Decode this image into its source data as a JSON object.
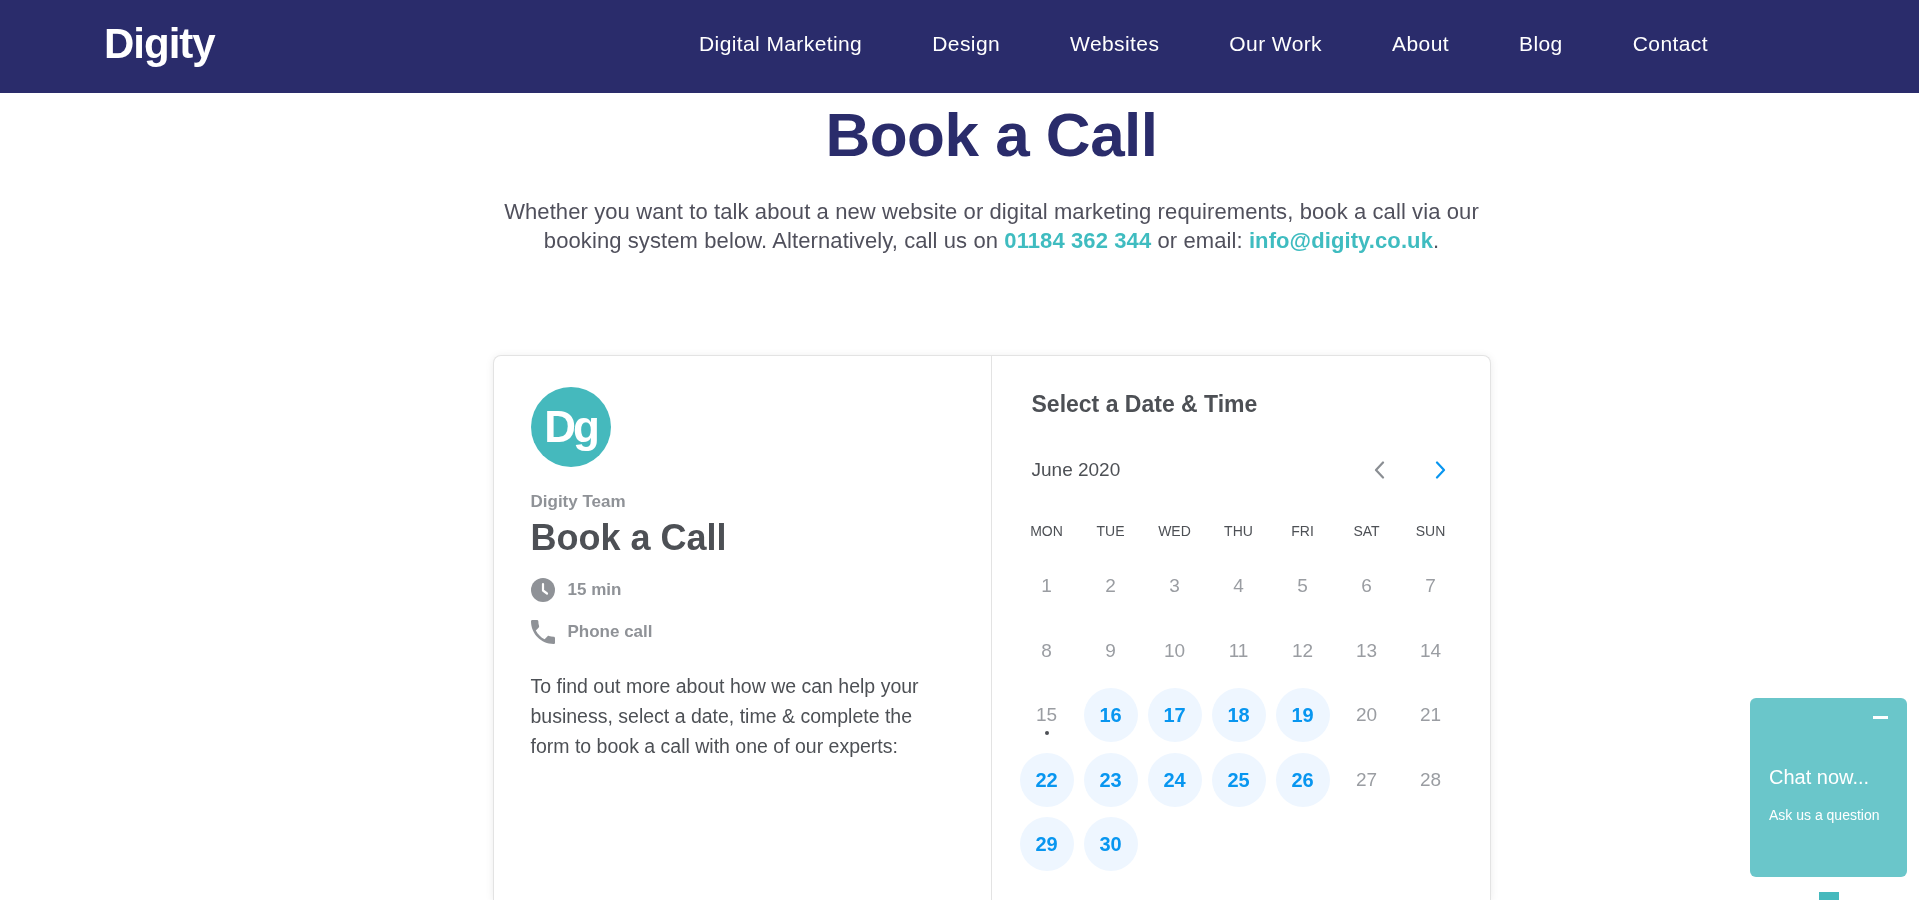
{
  "header": {
    "logo": "Digity",
    "nav": [
      {
        "label": "Digital Marketing"
      },
      {
        "label": "Design"
      },
      {
        "label": "Websites"
      },
      {
        "label": "Our Work"
      },
      {
        "label": "About"
      },
      {
        "label": "Blog"
      },
      {
        "label": "Contact"
      }
    ]
  },
  "intro": {
    "title": "Book a Call",
    "text_before": "Whether you want to talk about a new website or digital marketing requirements, book a call via our booking system below. Alternatively, call us on ",
    "phone": "01184 362 344",
    "text_middle": " or email: ",
    "email": "info@digity.co.uk",
    "text_after": "."
  },
  "event": {
    "logo": "Dg",
    "host": "Digity Team",
    "title": "Book a Call",
    "details": [
      {
        "kind": "duration",
        "text": "15 min"
      },
      {
        "kind": "location",
        "text": "Phone call"
      }
    ],
    "description": "To find out more about how we can help your business, select a date, time & complete the form to book a call with one of our experts:"
  },
  "calendar": {
    "heading": "Select a Date & Time",
    "month": "June 2020",
    "nav_buttons": [
      {
        "kind": "previous",
        "disabled": true
      },
      {
        "kind": "next",
        "disabled": false
      }
    ],
    "weekdays": [
      "MON",
      "TUE",
      "WED",
      "THU",
      "FRI",
      "SAT",
      "SUN"
    ],
    "days": [
      {
        "label": "1",
        "available": false,
        "today": false
      },
      {
        "label": "2",
        "available": false,
        "today": false
      },
      {
        "label": "3",
        "available": false,
        "today": false
      },
      {
        "label": "4",
        "available": false,
        "today": false
      },
      {
        "label": "5",
        "available": false,
        "today": false
      },
      {
        "label": "6",
        "available": false,
        "today": false
      },
      {
        "label": "7",
        "available": false,
        "today": false
      },
      {
        "label": "8",
        "available": false,
        "today": false
      },
      {
        "label": "9",
        "available": false,
        "today": false
      },
      {
        "label": "10",
        "available": false,
        "today": false
      },
      {
        "label": "11",
        "available": false,
        "today": false
      },
      {
        "label": "12",
        "available": false,
        "today": false
      },
      {
        "label": "13",
        "available": false,
        "today": false
      },
      {
        "label": "14",
        "available": false,
        "today": false
      },
      {
        "label": "15",
        "available": false,
        "today": true
      },
      {
        "label": "16",
        "available": true,
        "today": false
      },
      {
        "label": "17",
        "available": true,
        "today": false
      },
      {
        "label": "18",
        "available": true,
        "today": false
      },
      {
        "label": "19",
        "available": true,
        "today": false
      },
      {
        "label": "20",
        "available": false,
        "today": false
      },
      {
        "label": "21",
        "available": false,
        "today": false
      },
      {
        "label": "22",
        "available": true,
        "today": false
      },
      {
        "label": "23",
        "available": true,
        "today": false
      },
      {
        "label": "24",
        "available": true,
        "today": false
      },
      {
        "label": "25",
        "available": true,
        "today": false
      },
      {
        "label": "26",
        "available": true,
        "today": false
      },
      {
        "label": "27",
        "available": false,
        "today": false
      },
      {
        "label": "28",
        "available": false,
        "today": false
      },
      {
        "label": "29",
        "available": true,
        "today": false
      },
      {
        "label": "30",
        "available": true,
        "today": false
      }
    ]
  },
  "chat": {
    "title": "Chat now...",
    "subtitle": "Ask us a question"
  }
}
